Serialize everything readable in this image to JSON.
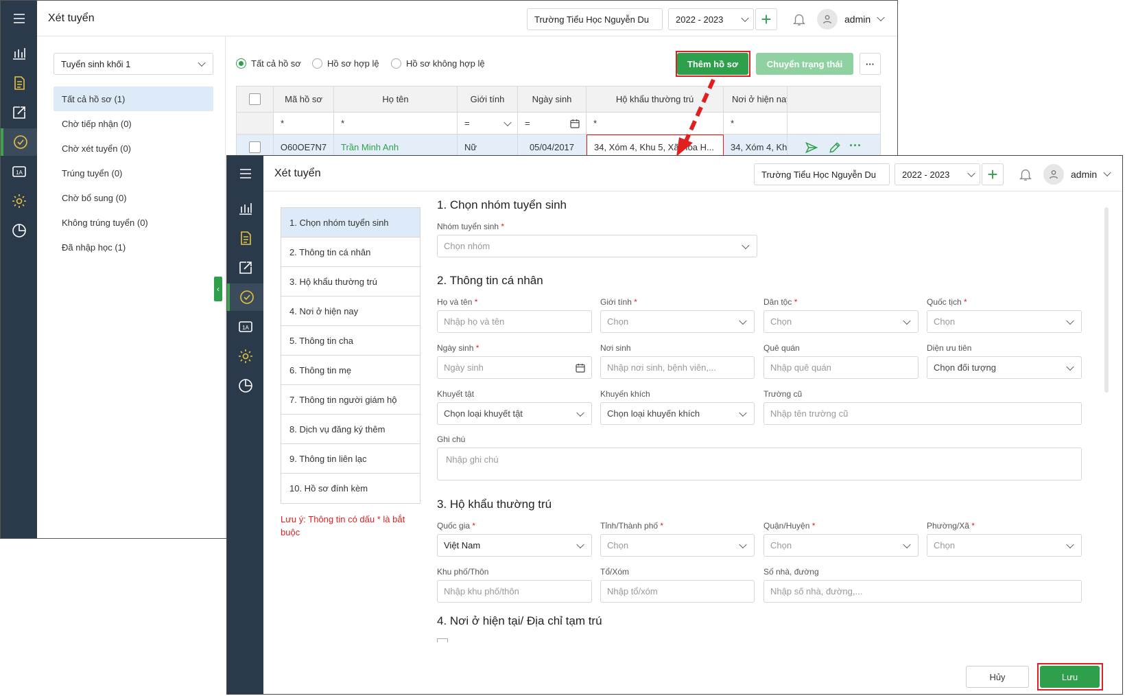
{
  "bg": {
    "title": "Xét tuyển",
    "school": "Trường Tiểu Học Nguyễn Du",
    "year": "2022 - 2023",
    "user": "admin",
    "group_select": "Tuyển sinh khối 1",
    "tree": [
      "Tất cả hồ sơ (1)",
      "Chờ tiếp nhận (0)",
      "Chờ xét tuyển (0)",
      "Trúng tuyển (0)",
      "Chờ bổ sung (0)",
      "Không trúng tuyển (0)",
      "Đã nhập học (1)"
    ],
    "filters": [
      "Tất cả hồ sơ",
      "Hồ sơ hợp lệ",
      "Hồ sơ không hợp lệ"
    ],
    "add_btn": "Thêm hồ sơ",
    "status_btn": "Chuyển trạng thái",
    "more": "···",
    "columns": [
      "Mã hồ sơ",
      "Họ tên",
      "Giới tính",
      "Ngày sinh",
      "Hộ khẩu thường trú",
      "Nơi ở hiện nay"
    ],
    "filter_ops": [
      "*",
      "*",
      "=",
      "=",
      "*",
      "*"
    ],
    "row": [
      "O60OE7N7",
      "Trần Minh Anh",
      "Nữ",
      "05/04/2017",
      "34, Xóm 4, Khu 5, Xã Hòa H...",
      "34, Xóm 4, Kh"
    ]
  },
  "dlg": {
    "title": "Xét tuyển",
    "school": "Trường Tiểu Học Nguyễn Du",
    "year": "2022 - 2023",
    "user": "admin",
    "steps": [
      "1. Chọn nhóm tuyển sinh",
      "2. Thông tin cá nhân",
      "3. Hộ khẩu thường trú",
      "4. Nơi ở hiện nay",
      "5. Thông tin cha",
      "6. Thông tin mẹ",
      "7. Thông tin người giám hộ",
      "8. Dịch vụ đăng ký thêm",
      "9. Thông tin liên lạc",
      "10. Hồ sơ đính kèm"
    ],
    "note": "Lưu ý: Thông tin có dấu * là bắt buộc",
    "sec1": "1. Chọn nhóm tuyển sinh",
    "group_label": "Nhóm tuyển sinh",
    "group_ph": "Chọn nhóm",
    "sec2": "2. Thông tin cá nhân",
    "name_label": "Họ và tên",
    "name_ph": "Nhập họ và tên",
    "gender_label": "Giới tính",
    "choose": "Chọn",
    "ethnic_label": "Dân tộc",
    "nation_label": "Quốc tịch",
    "dob_label": "Ngày sinh",
    "dob_ph": "Ngày sinh",
    "pob_label": "Nơi sinh",
    "pob_ph": "Nhập nơi sinh, bệnh viên,...",
    "home_label": "Quê quán",
    "home_ph": "Nhập quê quán",
    "prio_label": "Diện ưu tiên",
    "prio_ph": "Chọn đối tượng",
    "dis_label": "Khuyết tật",
    "dis_ph": "Chọn loại khuyết tật",
    "enc_label": "Khuyến khích",
    "enc_ph": "Chọn loại khuyến khích",
    "old_label": "Trường cũ",
    "old_ph": "Nhập tên trường cũ",
    "note_label": "Ghi chú",
    "note_ph": "Nhập ghi chú",
    "sec3": "3. Hộ khẩu thường trú",
    "country_label": "Quốc gia",
    "country_val": "Việt Nam",
    "prov_label": "Tỉnh/Thành phố",
    "dist_label": "Quận/Huyện",
    "ward_label": "Phường/Xã",
    "area_label": "Khu phố/Thôn",
    "area_ph": "Nhập khu phố/thôn",
    "hamlet_label": "Tổ/Xóm",
    "hamlet_ph": "Nhập tổ/xóm",
    "street_label": "Số nhà, đường",
    "street_ph": "Nhập số nhà, đường,...",
    "sec4": "4. Nơi ở hiện tại/ Địa chỉ tạm trú",
    "cancel": "Hủy",
    "save": "Lưu"
  },
  "colors": {
    "rail": "#2b3a4a",
    "green": "#2e9f4b",
    "red": "#e02020",
    "select": "#dcebf7"
  }
}
